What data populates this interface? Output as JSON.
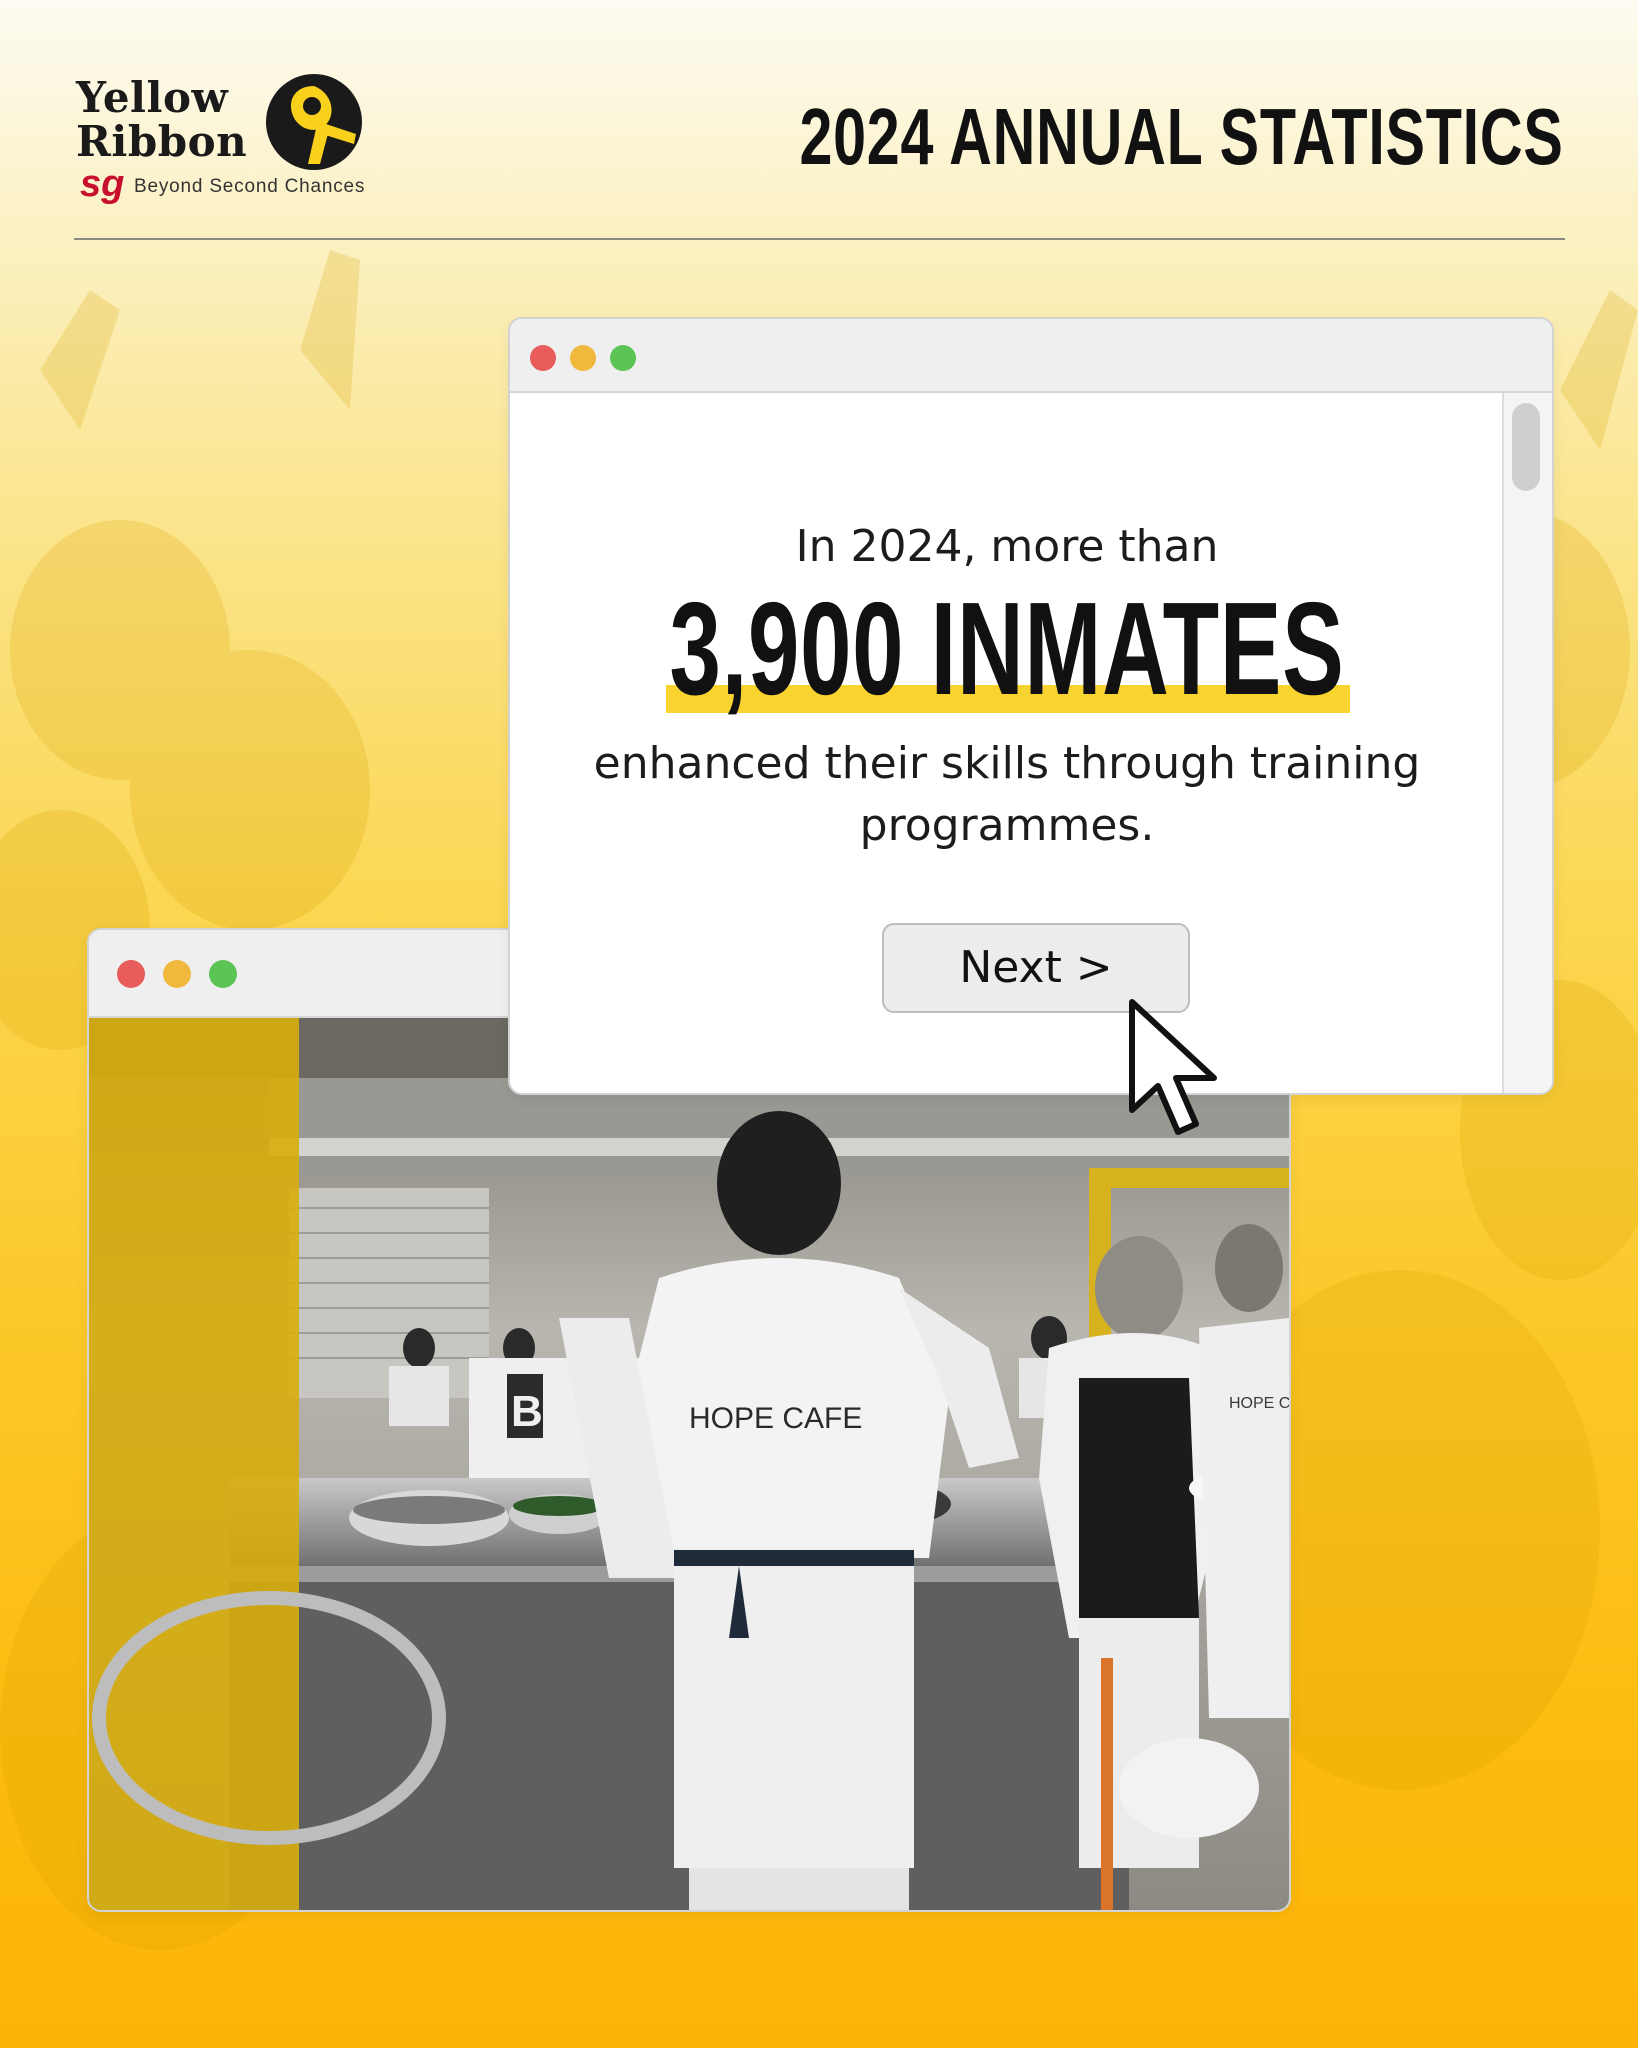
{
  "brand": {
    "name_line1": "Yellow",
    "name_line2": "Ribbon",
    "sg": "sg",
    "tagline": "Beyond Second Chances"
  },
  "header": {
    "title": "2024 ANNUAL STATISTICS"
  },
  "stat_window": {
    "lead": "In 2024, more than",
    "big_stat": "3,900 INMATES",
    "description": "enhanced their skills through training programmes.",
    "next_label": "Next >"
  },
  "photo_window": {
    "apron_text_main": "HOPE CAFE",
    "apron_text_side": "HOPE CA",
    "sign_text": "B"
  },
  "colors": {
    "accent_yellow": "#f9d430",
    "brand_red": "#c8102e",
    "dot_red": "#e85c5c",
    "dot_yellow": "#f0b83c",
    "dot_green": "#5cc455"
  },
  "icons": {
    "window_controls": [
      "close-dot",
      "minimize-dot",
      "maximize-dot"
    ],
    "pointer": "mouse-pointer-icon"
  }
}
